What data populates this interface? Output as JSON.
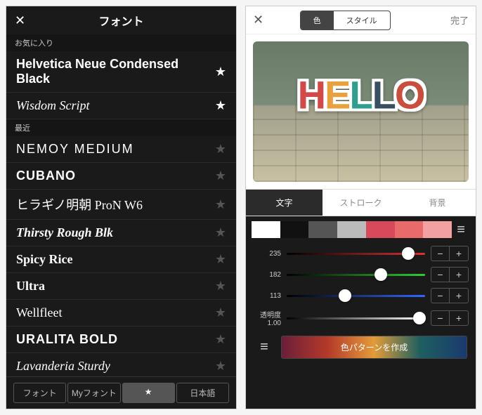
{
  "left": {
    "close_icon": "✕",
    "title": "フォント",
    "section_fav": "お気に入り",
    "section_recent": "最近",
    "fonts": [
      {
        "name": "Helvetica Neue Condensed Black",
        "cls": "bold",
        "fav": true
      },
      {
        "name": "Wisdom Script",
        "cls": "script",
        "fav": true
      },
      {
        "name": "NEMOY MEDIUM",
        "cls": "nemoy",
        "fav": false
      },
      {
        "name": "CUBANO",
        "cls": "cubano",
        "fav": false
      },
      {
        "name": "ヒラギノ明朝 ProN W6",
        "cls": "serif",
        "fav": false
      },
      {
        "name": "Thirsty Rough Blk",
        "cls": "script bold",
        "fav": false
      },
      {
        "name": "Spicy Rice",
        "cls": "slab",
        "fav": false
      },
      {
        "name": "Ultra",
        "cls": "slab",
        "fav": false
      },
      {
        "name": "Wellfleet",
        "cls": "wf",
        "fav": false
      },
      {
        "name": "URALITA BOLD",
        "cls": "ural",
        "fav": false
      },
      {
        "name": "Lavanderia Sturdy",
        "cls": "lav",
        "fav": false
      }
    ],
    "tabs": [
      "フォント",
      "Myフォント",
      "★",
      "日本語"
    ],
    "tab_selected": 2
  },
  "right": {
    "close_icon": "✕",
    "segments": [
      "色",
      "スタイル"
    ],
    "segment_selected": 0,
    "done": "完了",
    "preview_text": "HELLO",
    "preview_colors": [
      "#d04a47",
      "#e7a13e",
      "#2f9e8e",
      "#3a4e62",
      "#c84f3d"
    ],
    "attr_tabs": [
      "文字",
      "ストローク",
      "背景"
    ],
    "attr_selected": 0,
    "swatches": [
      "#ffffff",
      "#111111",
      "#555555",
      "#bbbbbb",
      "#d9495c",
      "#e86a6a",
      "#f2a0a0"
    ],
    "sliders": [
      {
        "label": "235",
        "color": "#d33",
        "pct": 88
      },
      {
        "label": "182",
        "color": "#3c3",
        "pct": 68
      },
      {
        "label": "113",
        "color": "#36f",
        "pct": 42
      },
      {
        "label": "透明度",
        "value": "1.00",
        "color": "#fff",
        "pct": 96
      }
    ],
    "pattern_button": "色パターンを作成"
  }
}
